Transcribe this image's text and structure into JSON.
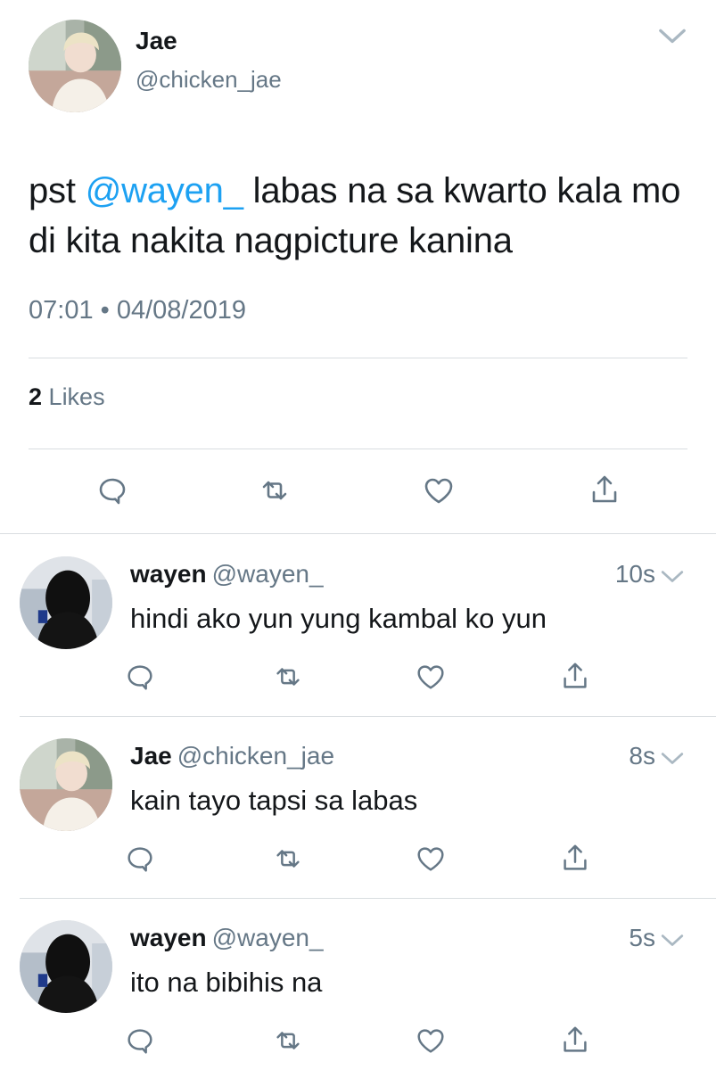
{
  "main_tweet": {
    "name": "Jae",
    "handle": "@chicken_jae",
    "text_before": "pst ",
    "mention": "@wayen_",
    "text_after": " labas na sa kwarto kala mo di kita nakita nagpicture kanina",
    "time": "07:01",
    "separator": "•",
    "date": "04/08/2019",
    "likes_count": "2",
    "likes_label": "Likes",
    "avatar": "photo-avatar-light",
    "icons": [
      "reply-icon",
      "retweet-icon",
      "like-icon",
      "share-icon",
      "chevron-down-icon"
    ]
  },
  "replies": [
    {
      "name": "wayen",
      "handle": "@wayen_",
      "time": "10s",
      "text": "hindi ako yun yung kambal ko yun",
      "avatar": "photo-avatar-dark"
    },
    {
      "name": "Jae",
      "handle": "@chicken_jae",
      "time": "8s",
      "text": "kain tayo tapsi sa labas",
      "avatar": "photo-avatar-light"
    },
    {
      "name": "wayen",
      "handle": "@wayen_",
      "time": "5s",
      "text": "ito na bibihis na",
      "avatar": "photo-avatar-dark"
    }
  ],
  "colors": {
    "link": "#1da1f2",
    "secondary": "#657786",
    "text": "#14171a",
    "divider": "#d9dde0"
  }
}
